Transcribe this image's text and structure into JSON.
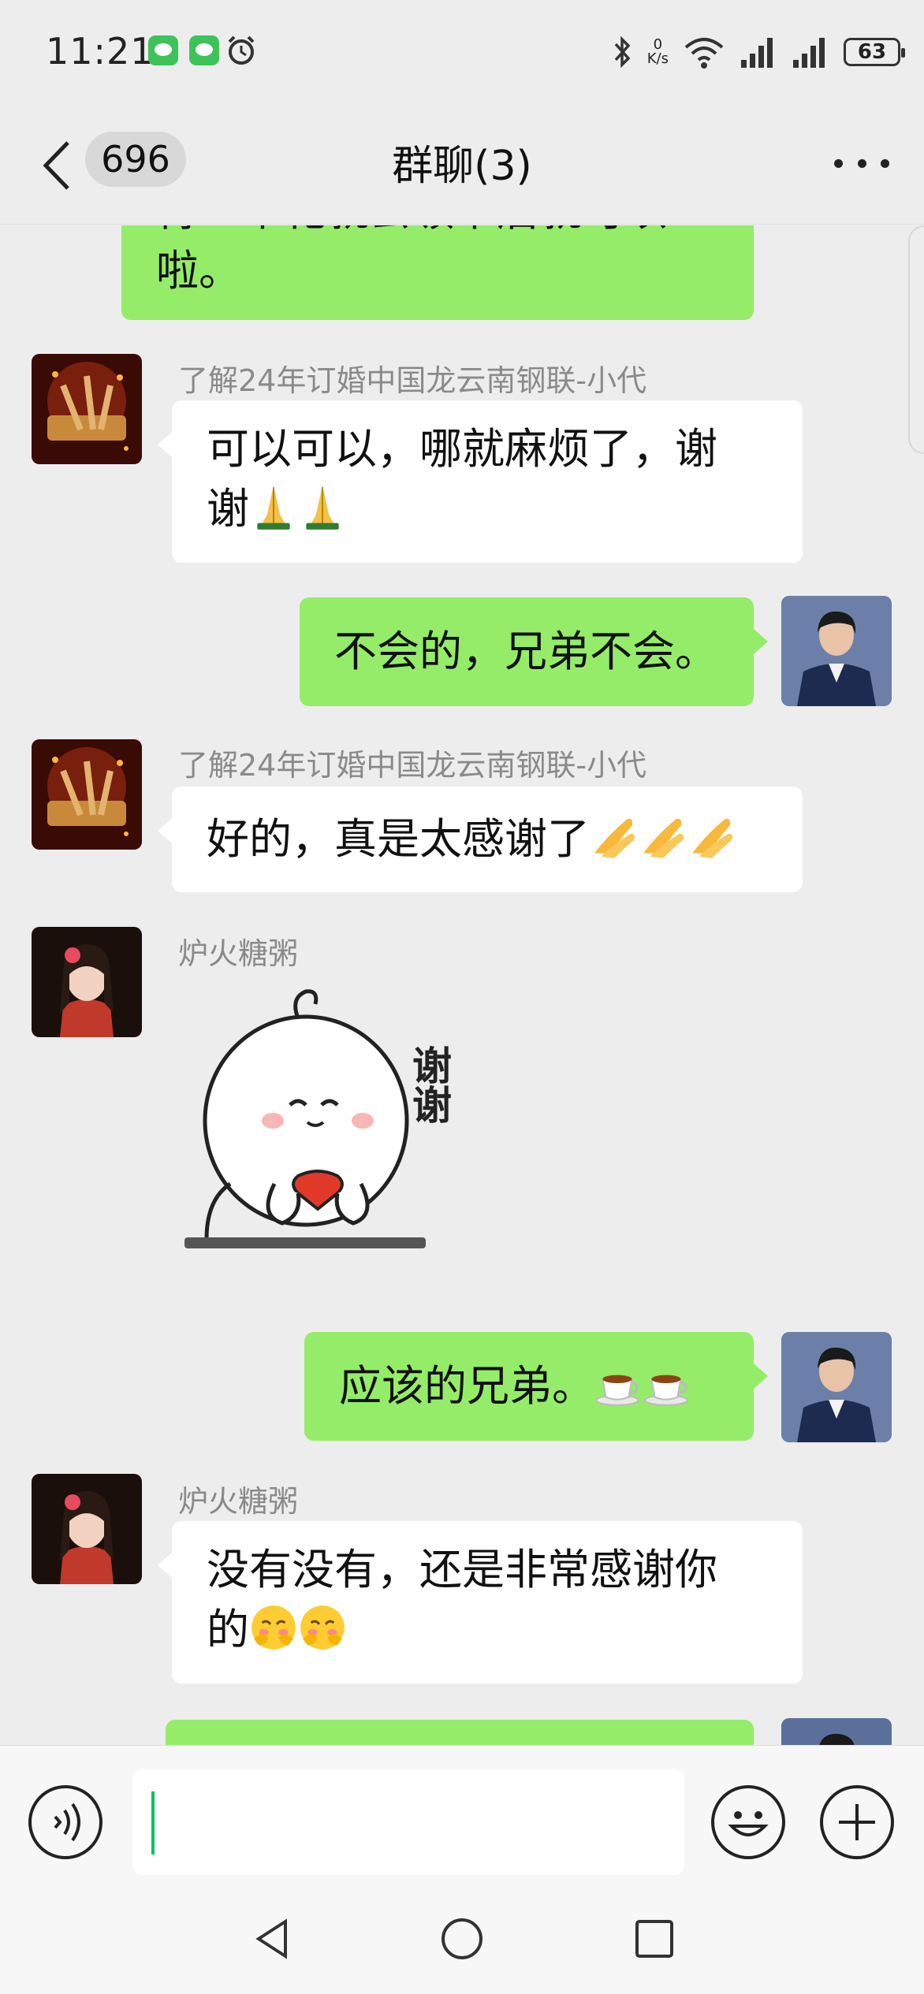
{
  "status_bar": {
    "time": "11:21",
    "net_speed_value": "0",
    "net_speed_unit": "K/s",
    "battery": "63"
  },
  "nav": {
    "unread_count": "696",
    "title": "群聊(3)"
  },
  "messages": [
    {
      "side": "right",
      "text_top_partial": "得一个花就去领下后就可以",
      "text": "啦。"
    },
    {
      "side": "left",
      "sender": "了解24年订婚中国龙云南钢联-小代",
      "line1": "可以可以，哪就麻烦了，谢",
      "line2": "谢",
      "emojis": [
        "folded-hands",
        "folded-hands"
      ]
    },
    {
      "side": "right",
      "text": "不会的，兄弟不会。"
    },
    {
      "side": "left",
      "sender": "了解24年订婚中国龙云南钢联-小代",
      "text": "好的，真是太感谢了",
      "emojis": [
        "folded-hands",
        "folded-hands",
        "folded-hands"
      ]
    },
    {
      "side": "left",
      "sender": "炉火糖粥",
      "sticker_text": "谢谢"
    },
    {
      "side": "right",
      "text": "应该的兄弟。",
      "emojis": [
        "coffee",
        "coffee"
      ]
    },
    {
      "side": "left",
      "sender": "炉火糖粥",
      "line1": "没有没有，还是非常感谢你",
      "line2": "的",
      "emojis": [
        "shy-face",
        "shy-face"
      ]
    }
  ],
  "colors": {
    "background": "#ededed",
    "bubble_self": "#95ec69",
    "bubble_other": "#ffffff",
    "caret": "#07c160"
  }
}
